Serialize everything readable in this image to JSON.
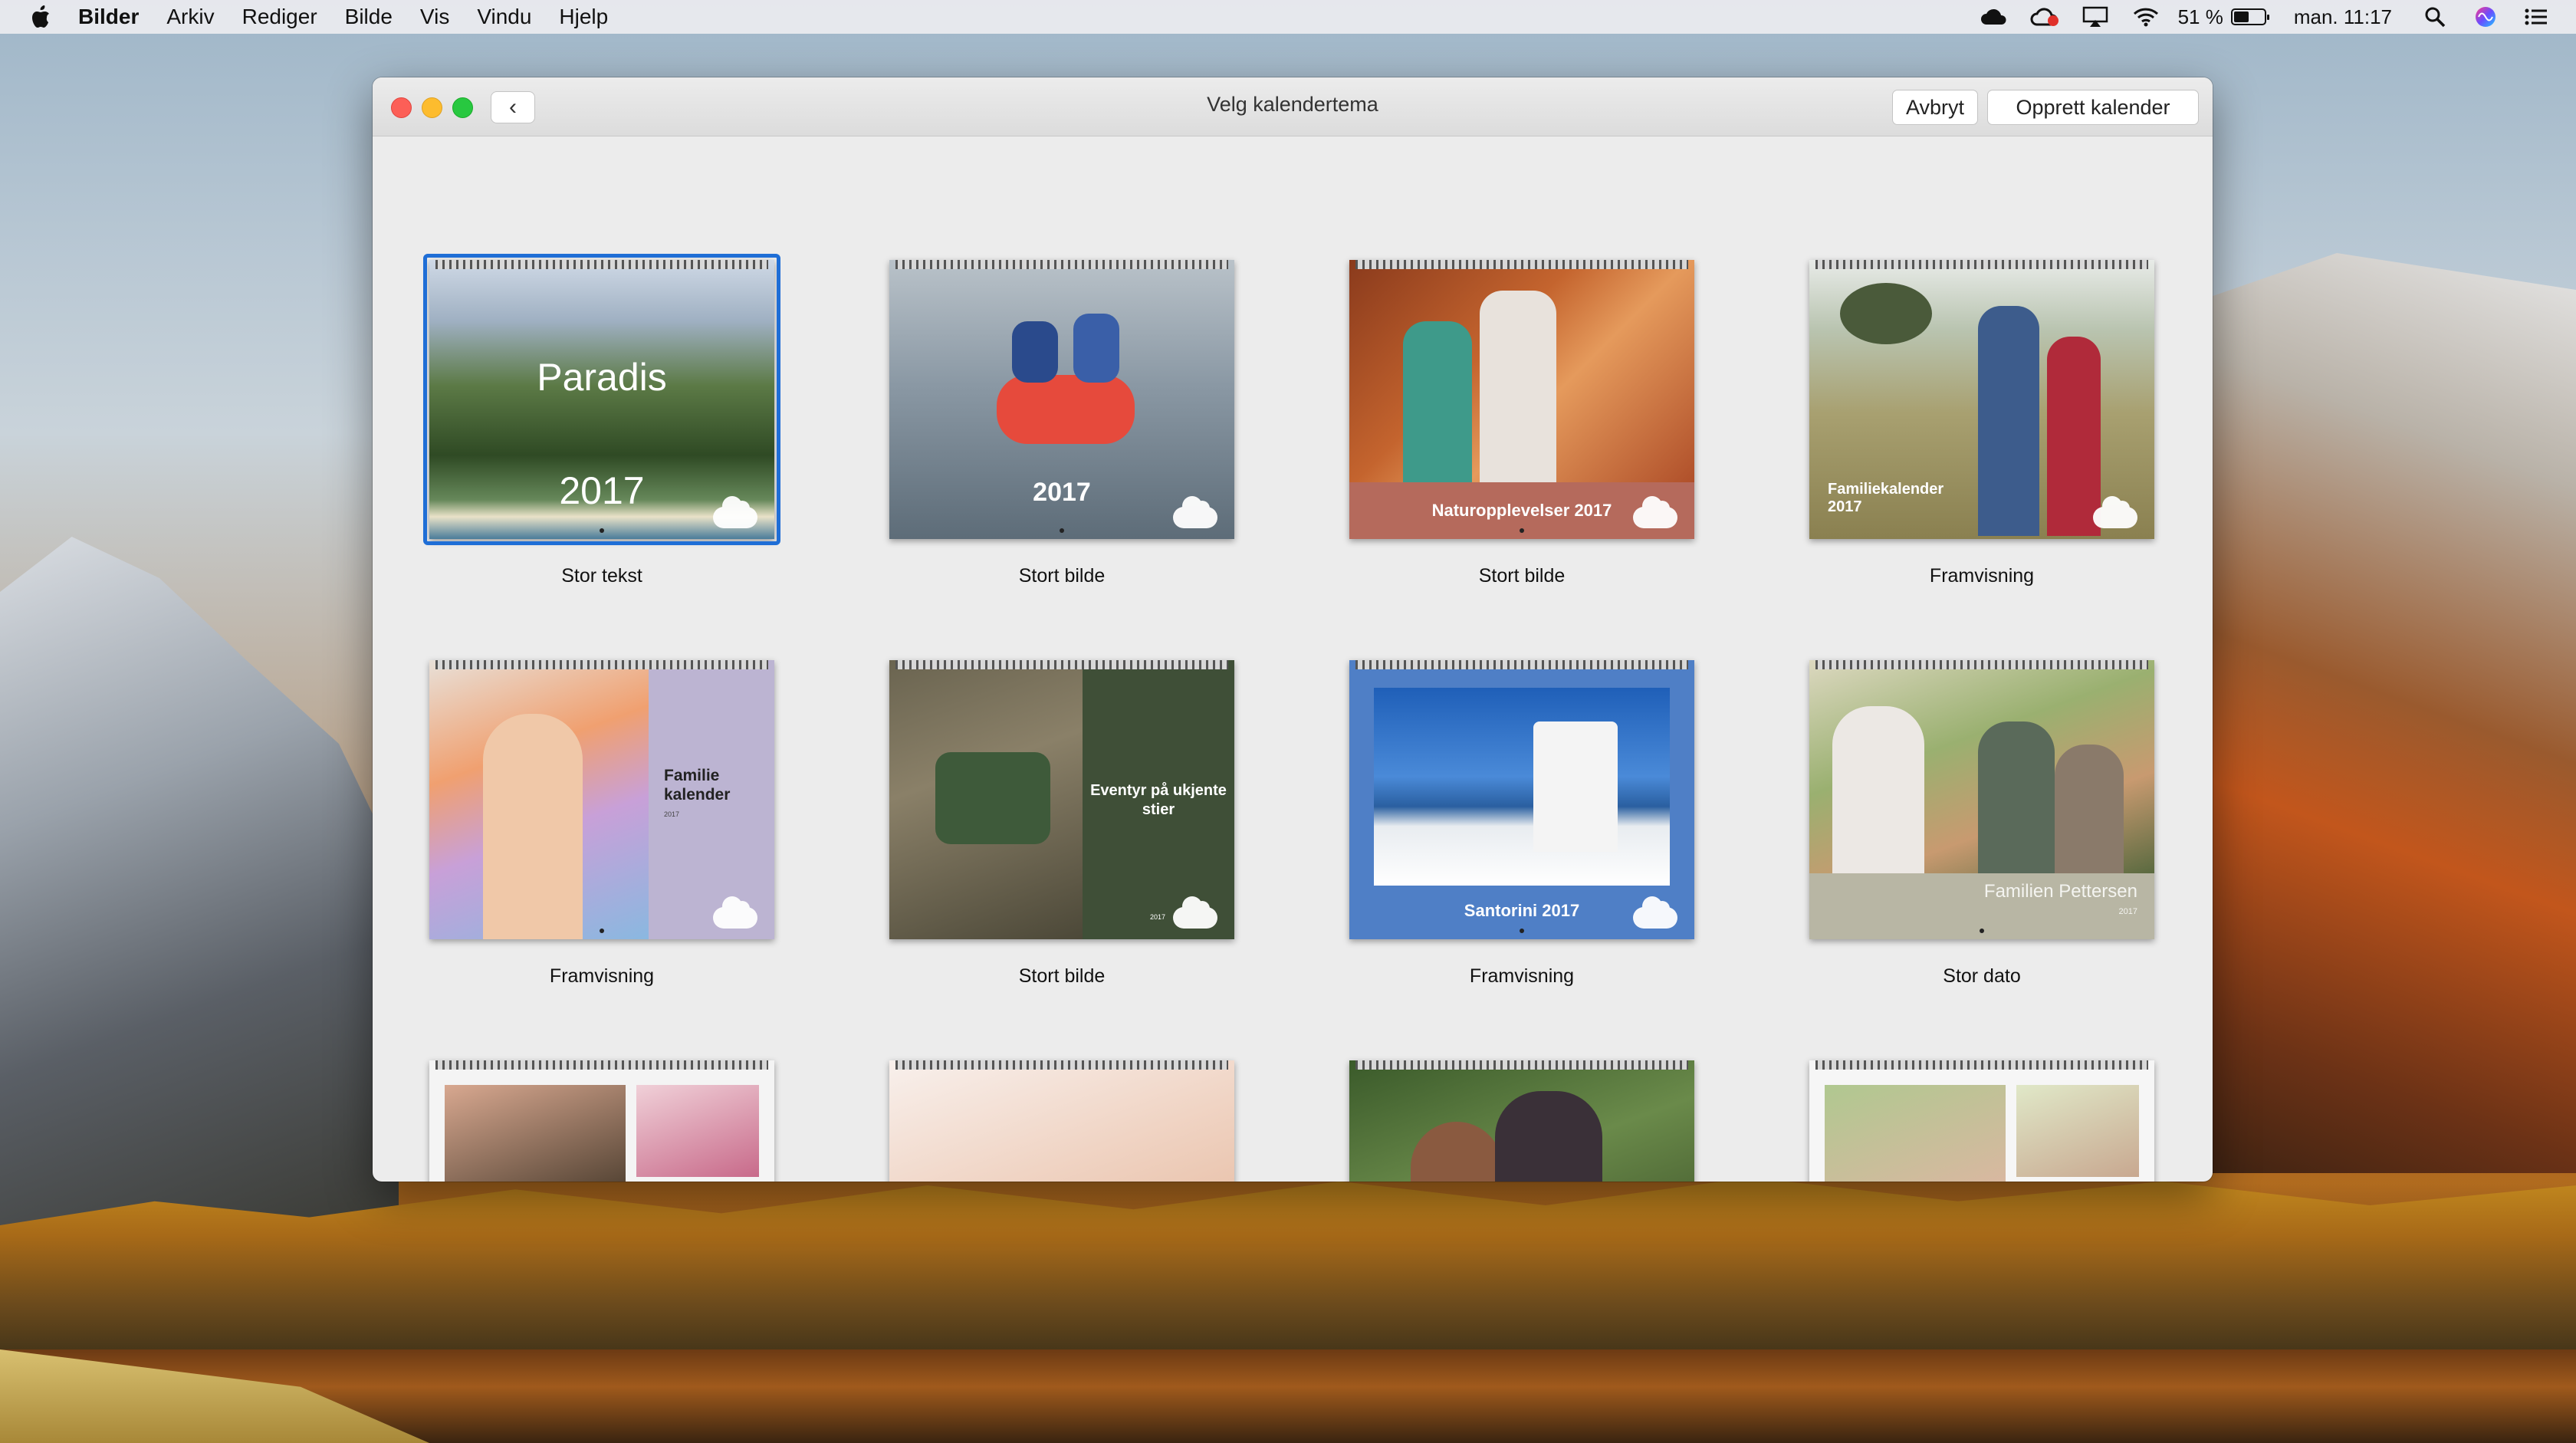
{
  "menubar": {
    "app_name": "Bilder",
    "menus": [
      "Arkiv",
      "Rediger",
      "Bilde",
      "Vis",
      "Vindu",
      "Hjelp"
    ],
    "battery_text": "51 %",
    "battery_level": 0.51,
    "clock": "man. 11:17"
  },
  "window": {
    "title": "Velg kalendertema",
    "cancel_label": "Avbryt",
    "create_label": "Opprett kalender",
    "back_icon": "‹"
  },
  "themes": [
    {
      "label": "Stor tekst",
      "cover_title": "Paradis",
      "cover_year": "2017",
      "selected": true
    },
    {
      "label": "Stort bilde",
      "cover_year": "2017"
    },
    {
      "label": "Stort bilde",
      "cover_caption": "Naturopplevelser 2017"
    },
    {
      "label": "Framvisning",
      "cover_caption": "Familiekalender 2017"
    },
    {
      "label": "Framvisning",
      "cover_caption": "Familie kalender",
      "cover_small": "2017"
    },
    {
      "label": "Stort bilde",
      "cover_caption": "Eventyr på ukjente stier",
      "cover_small": "2017"
    },
    {
      "label": "Framvisning",
      "cover_caption": "Santorini 2017"
    },
    {
      "label": "Stor dato",
      "cover_caption": "Familien Pettersen",
      "cover_small": "2017"
    },
    {
      "label": ""
    },
    {
      "label": ""
    },
    {
      "label": ""
    },
    {
      "label": ""
    }
  ]
}
